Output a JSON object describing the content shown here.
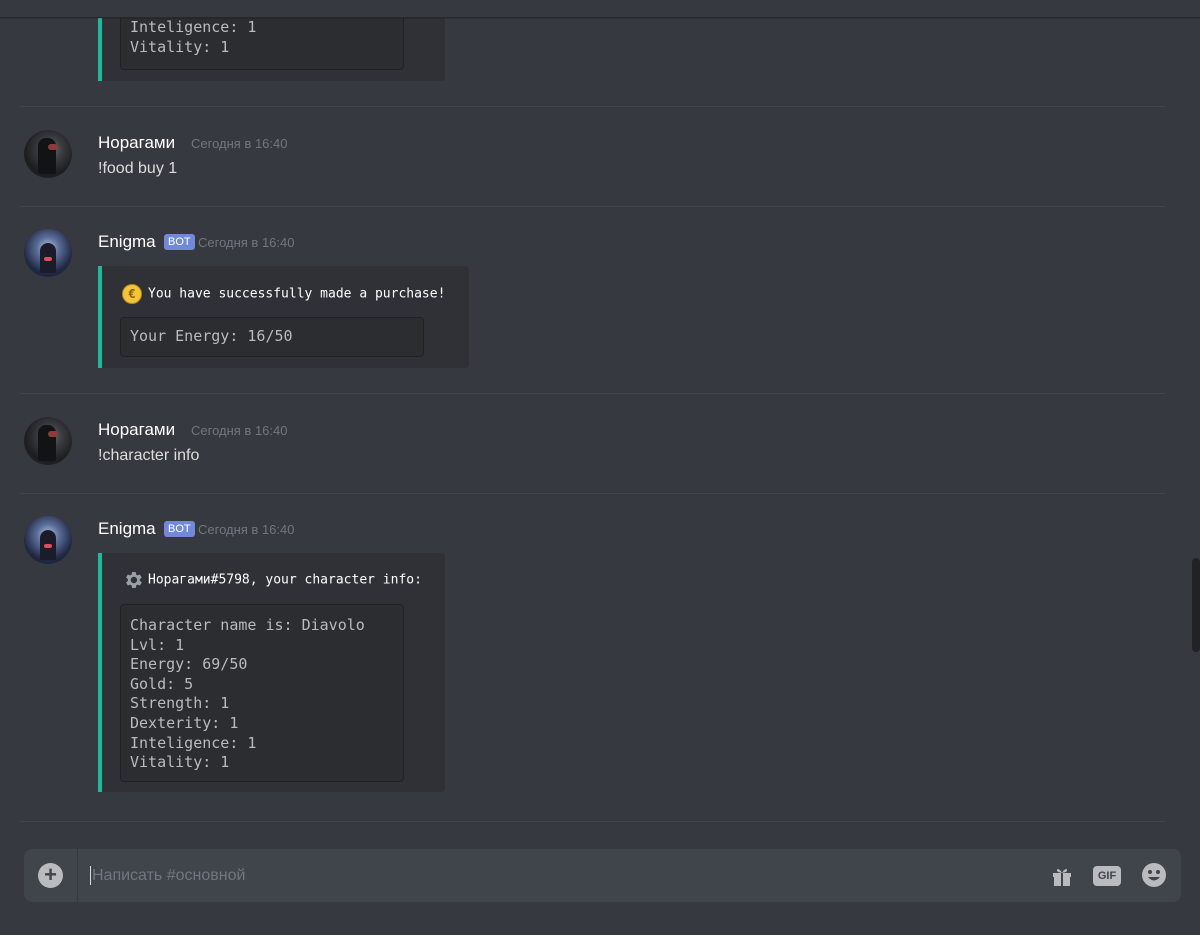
{
  "messages": {
    "prev_embed_lines": [
      "Inteligence: 1",
      "Vitality: 1"
    ],
    "msg1": {
      "author": "Норагами",
      "timestamp": "Сегодня в 16:40",
      "text": "!food buy 1"
    },
    "msg2": {
      "author": "Enigma",
      "bot_tag": "BOT",
      "timestamp": "Сегодня в 16:40",
      "embed": {
        "title": "You have successfully made a purchase!",
        "icon": "coin-icon",
        "code_lines": [
          "Your Energy: 16/50"
        ]
      }
    },
    "msg3": {
      "author": "Норагами",
      "timestamp": "Сегодня в 16:40",
      "text": "!character info"
    },
    "msg4": {
      "author": "Enigma",
      "bot_tag": "BOT",
      "timestamp": "Сегодня в 16:40",
      "embed": {
        "title": "Норагами#5798, your character info:",
        "icon": "gear-icon",
        "code_lines": [
          "Character name is: Diavolo",
          "Lvl: 1",
          "Energy: 69/50",
          "Gold: 5",
          "Strength: 1",
          "Dexterity: 1",
          "Inteligence: 1",
          "Vitality: 1"
        ]
      }
    }
  },
  "composer": {
    "placeholder": "Написать #основной",
    "gif_label": "GIF",
    "icons": [
      "plus-circle-icon",
      "gift-icon",
      "gif-icon",
      "emoji-icon"
    ]
  },
  "colors": {
    "background": "#36393f",
    "embed_bg": "#2f3136",
    "embed_accent": "#1abc9c",
    "bot_tag": "#7289da",
    "composer_bg": "#40444b"
  }
}
